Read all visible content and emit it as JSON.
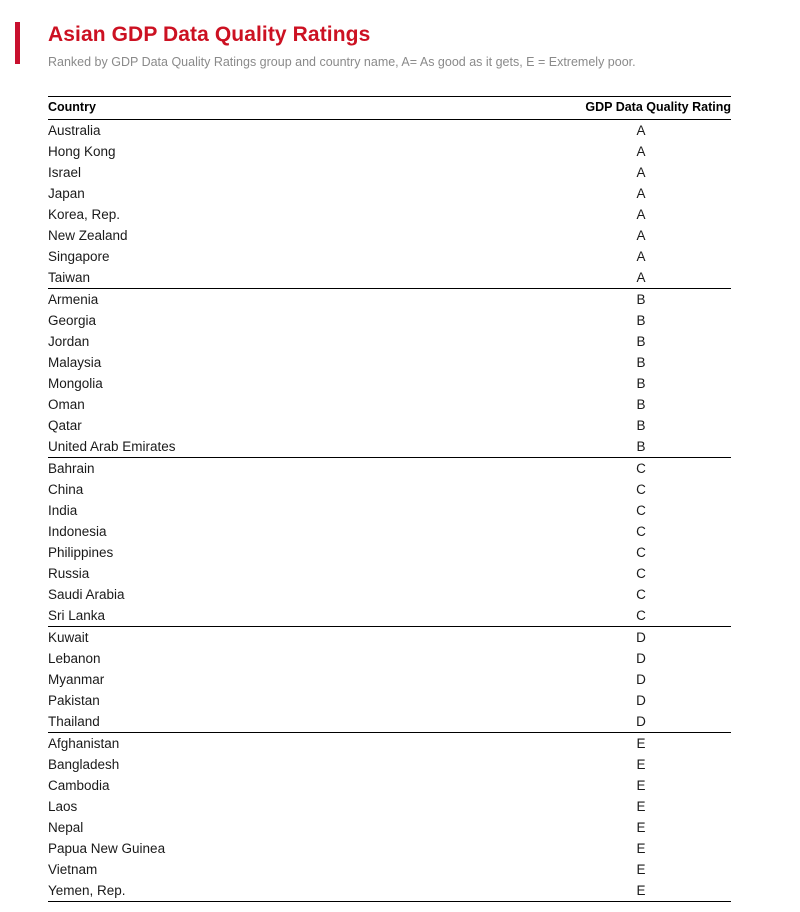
{
  "header": {
    "title": "Asian GDP Data Quality Ratings",
    "subtitle": "Ranked by GDP Data Quality Ratings group and country name, A= As good as it gets, E = Extremely poor.",
    "accent_color": "#c8102e",
    "title_color": "#cc1122",
    "subtitle_color": "#8a8a8a"
  },
  "table": {
    "columns": [
      "Country",
      "GDP Data Quality Rating"
    ],
    "groups": [
      {
        "rating": "A",
        "rows": [
          {
            "country": "Australia",
            "rating": "A"
          },
          {
            "country": "Hong Kong",
            "rating": "A"
          },
          {
            "country": "Israel",
            "rating": "A"
          },
          {
            "country": "Japan",
            "rating": "A"
          },
          {
            "country": "Korea, Rep.",
            "rating": "A"
          },
          {
            "country": "New Zealand",
            "rating": "A"
          },
          {
            "country": "Singapore",
            "rating": "A"
          },
          {
            "country": "Taiwan",
            "rating": "A"
          }
        ]
      },
      {
        "rating": "B",
        "rows": [
          {
            "country": "Armenia",
            "rating": "B"
          },
          {
            "country": "Georgia",
            "rating": "B"
          },
          {
            "country": "Jordan",
            "rating": "B"
          },
          {
            "country": "Malaysia",
            "rating": "B"
          },
          {
            "country": "Mongolia",
            "rating": "B"
          },
          {
            "country": "Oman",
            "rating": "B"
          },
          {
            "country": "Qatar",
            "rating": "B"
          },
          {
            "country": "United Arab Emirates",
            "rating": "B"
          }
        ]
      },
      {
        "rating": "C",
        "rows": [
          {
            "country": "Bahrain",
            "rating": "C"
          },
          {
            "country": "China",
            "rating": "C"
          },
          {
            "country": "India",
            "rating": "C"
          },
          {
            "country": "Indonesia",
            "rating": "C"
          },
          {
            "country": "Philippines",
            "rating": "C"
          },
          {
            "country": "Russia",
            "rating": "C"
          },
          {
            "country": "Saudi Arabia",
            "rating": "C"
          },
          {
            "country": "Sri Lanka",
            "rating": "C"
          }
        ]
      },
      {
        "rating": "D",
        "rows": [
          {
            "country": "Kuwait",
            "rating": "D"
          },
          {
            "country": "Lebanon",
            "rating": "D"
          },
          {
            "country": "Myanmar",
            "rating": "D"
          },
          {
            "country": "Pakistan",
            "rating": "D"
          },
          {
            "country": "Thailand",
            "rating": "D"
          }
        ]
      },
      {
        "rating": "E",
        "rows": [
          {
            "country": "Afghanistan",
            "rating": "E"
          },
          {
            "country": "Bangladesh",
            "rating": "E"
          },
          {
            "country": "Cambodia",
            "rating": "E"
          },
          {
            "country": "Laos",
            "rating": "E"
          },
          {
            "country": "Nepal",
            "rating": "E"
          },
          {
            "country": "Papua New Guinea",
            "rating": "E"
          },
          {
            "country": "Vietnam",
            "rating": "E"
          },
          {
            "country": "Yemen, Rep.",
            "rating": "E"
          }
        ]
      }
    ]
  }
}
